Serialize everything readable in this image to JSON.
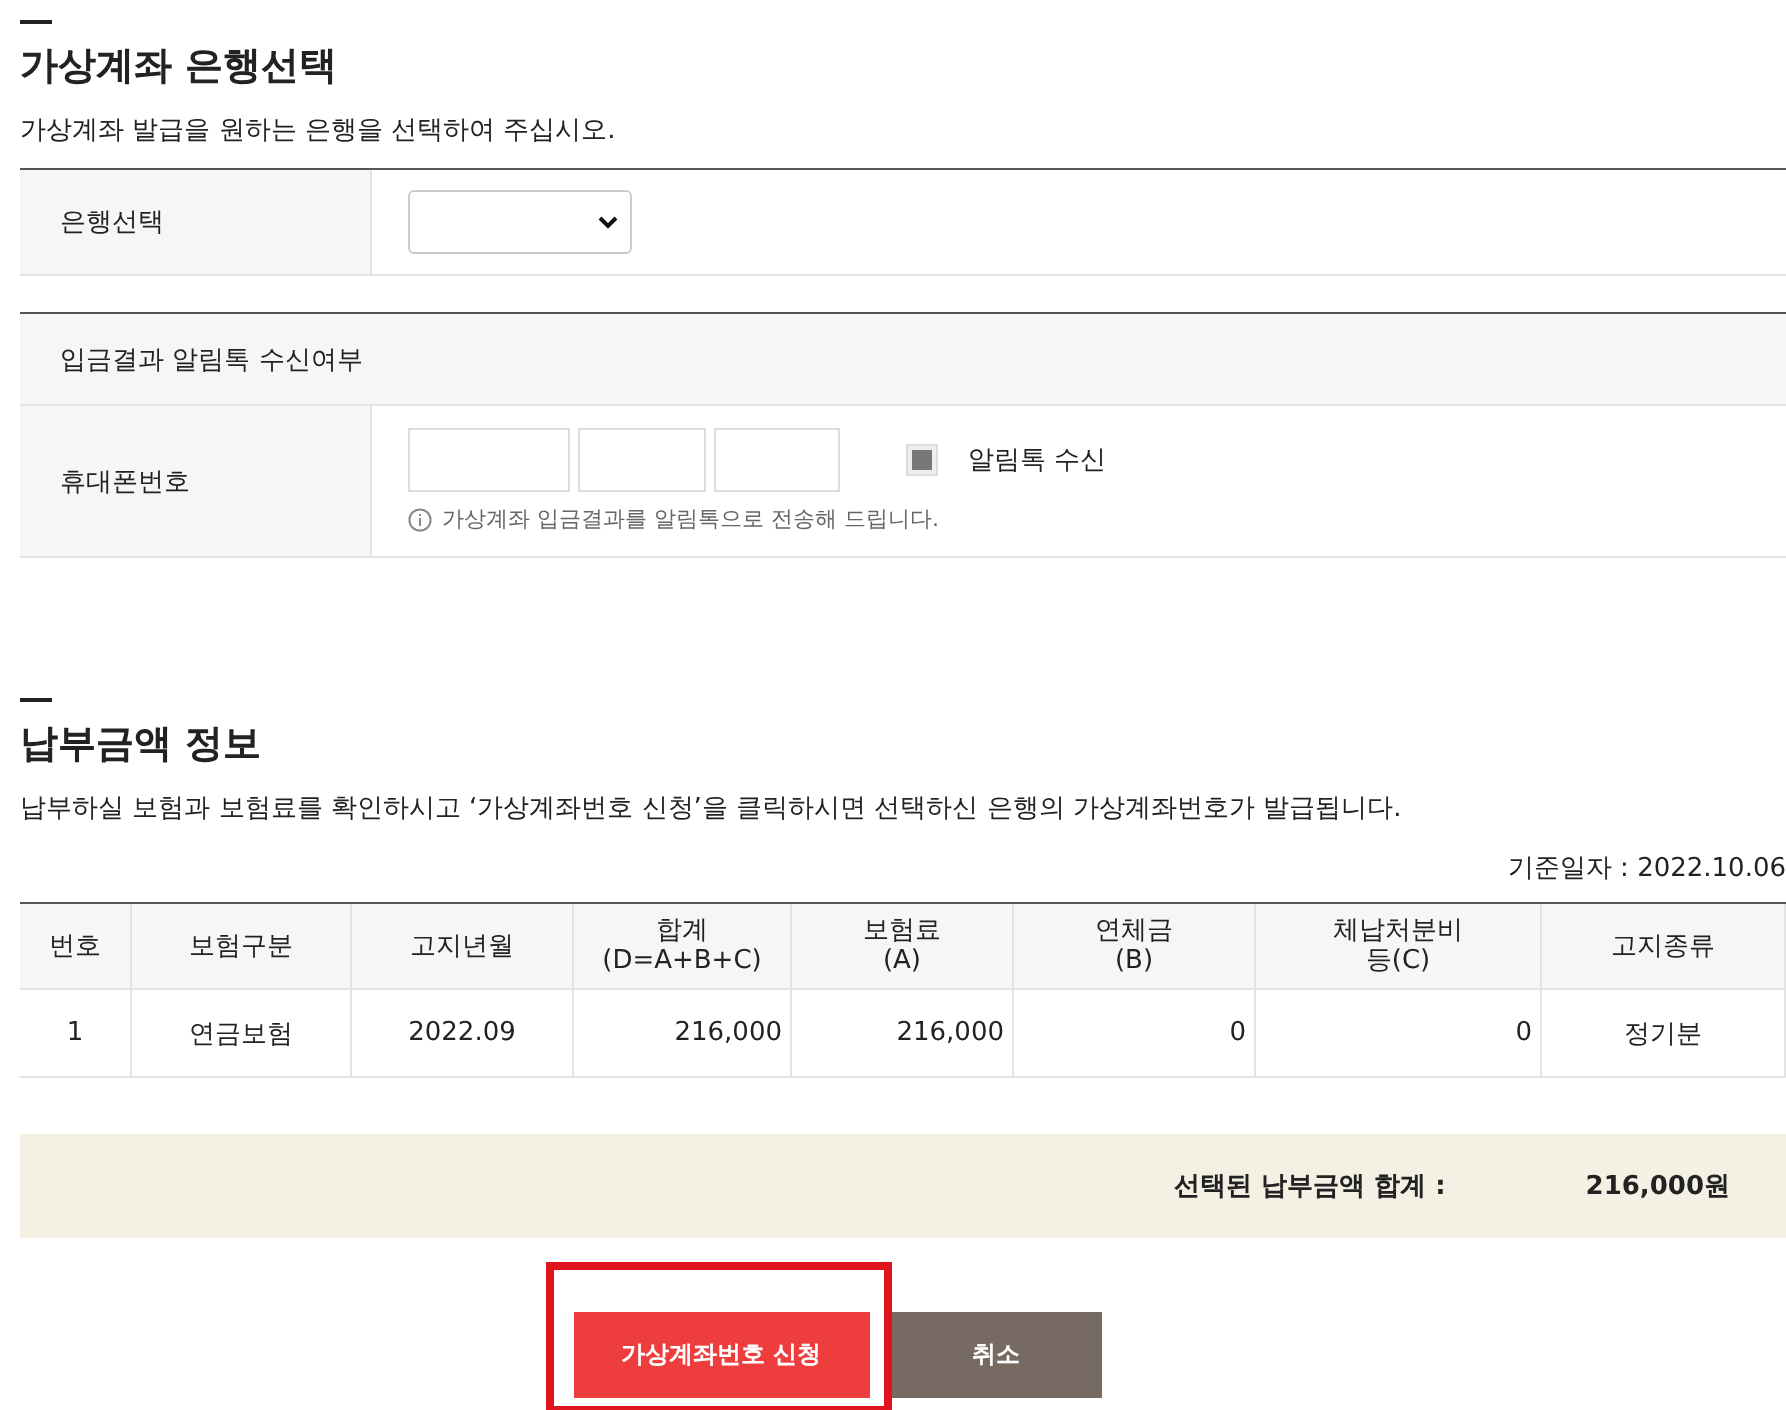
{
  "bank_section": {
    "title": "가상계좌 은행선택",
    "description": "가상계좌 발급을 원하는 은행을 선택하여 주십시오.",
    "bank_label": "은행선택"
  },
  "notify_section": {
    "header": "입금결과 알림톡 수신여부",
    "phone_label": "휴대폰번호",
    "notify_checkbox": {
      "label": "알림톡 수신",
      "checked": true
    },
    "hint": "가상계좌 입금결과를 알림톡으로 전송해 드립니다."
  },
  "payment_section": {
    "title": "납부금액 정보",
    "description": "납부하실 보험과 보험료를 확인하시고 ‘가상계좌번호 신청’을 클릭하시면 선택하신 은행의 가상계좌번호가 발급됩니다.",
    "base_date": "기준일자 : 2022.10.06"
  },
  "table": {
    "columns": [
      "번호",
      "보험구분",
      "고지년월",
      "합계\n(D=A+B+C)",
      "보험료\n(A)",
      "연체금\n(B)",
      "체납처분비\n등(C)",
      "고지종류"
    ],
    "rows": [
      [
        "1",
        "연금보험",
        "2022.09",
        "216,000",
        "216,000",
        "0",
        "0",
        "정기분"
      ]
    ]
  },
  "summary": {
    "label": "선택된 납부금액 합계 :",
    "amount": "216,000원"
  },
  "buttons": [
    {
      "label": "가상계좌번호 신청",
      "kind": "primary",
      "highlighted": true
    },
    {
      "label": "취소",
      "kind": "secondary",
      "highlighted": false
    }
  ]
}
